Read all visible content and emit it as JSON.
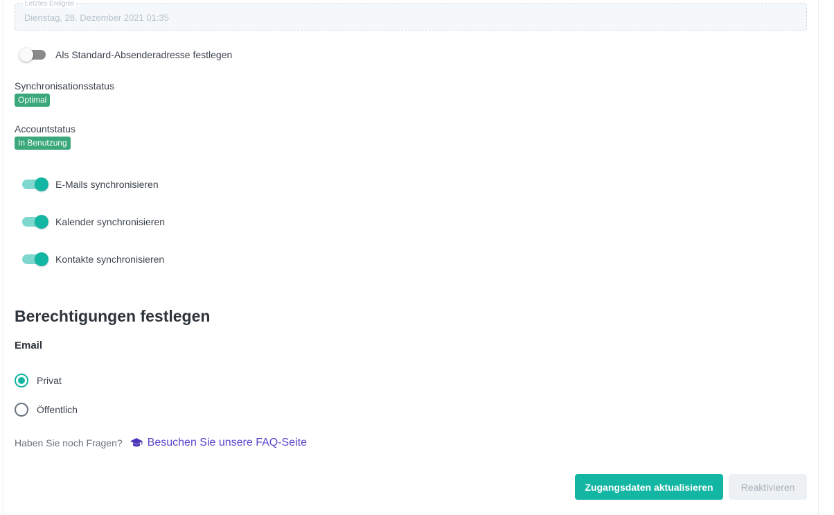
{
  "last_event": {
    "legend": "Letztes Ereignis",
    "value": "Dienstag, 28. Dezember 2021 01:35"
  },
  "default_sender": {
    "label": "Als Standard-Absenderadresse festlegen",
    "enabled": false
  },
  "sync_status": {
    "label": "Synchronisationsstatus",
    "badge": "Optimal"
  },
  "account_status": {
    "label": "Accountstatus",
    "badge": "In Benutzung"
  },
  "sync_toggles": [
    {
      "label": "E-Mails synchronisieren",
      "enabled": true
    },
    {
      "label": "Kalender synchronisieren",
      "enabled": true
    },
    {
      "label": "Kontakte synchronisieren",
      "enabled": true
    }
  ],
  "permissions": {
    "title": "Berechtigungen festlegen",
    "email_title": "Email",
    "options": [
      {
        "label": "Privat",
        "selected": true
      },
      {
        "label": "Öffentlich",
        "selected": false
      }
    ]
  },
  "faq": {
    "question": "Haben Sie noch Fragen?",
    "link_label": "Besuchen Sie unsere FAQ-Seite",
    "icon": "graduation-cap-icon"
  },
  "buttons": {
    "update_credentials": "Zugangsdaten aktualisieren",
    "reactivate": "Reaktivieren"
  },
  "colors": {
    "accent": "#13b5a3",
    "badge_green": "#3aa87a",
    "link_purple": "#5a46cc"
  }
}
